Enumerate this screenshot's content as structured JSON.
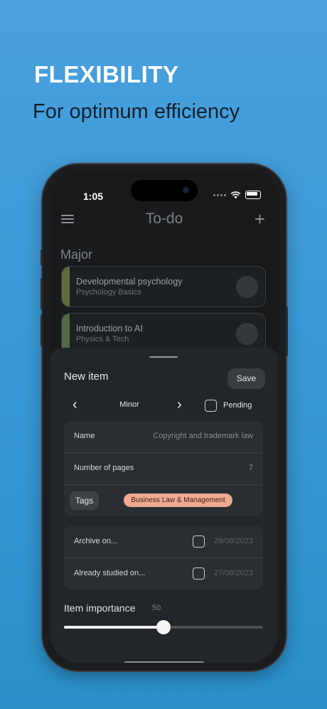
{
  "promo": {
    "headline": "FLEXIBILITY",
    "subline": "For optimum efficiency"
  },
  "status_bar": {
    "time": "1:05"
  },
  "nav": {
    "title": "To-do"
  },
  "section": {
    "title": "Major"
  },
  "cards": [
    {
      "title": "Developmental psychology",
      "subtitle": "Psychology Basics",
      "accent": "#5f6b3c"
    },
    {
      "title": "Introduction to AI",
      "subtitle": "Physics & Tech",
      "accent": "#4f6a44"
    }
  ],
  "sheet": {
    "title": "New item",
    "save_label": "Save",
    "priority": "Minor",
    "pending_label": "Pending",
    "fields": {
      "name_label": "Name",
      "name_value": "Copyright and trademark law",
      "pages_label": "Number of pages",
      "pages_value": "7",
      "tags_label": "Tags",
      "tag": "Business Law & Management"
    },
    "dates": {
      "archive_label": "Archive on...",
      "archive_value": "28/08/2023",
      "studied_label": "Already studied on...",
      "studied_value": "27/08/2023"
    },
    "importance": {
      "label": "Item importance",
      "value": "50",
      "fraction": 0.5
    }
  },
  "colors": {
    "background_top": "#4aa0dd",
    "tag_pill": "#f0a890",
    "sheet": "#22262a"
  }
}
